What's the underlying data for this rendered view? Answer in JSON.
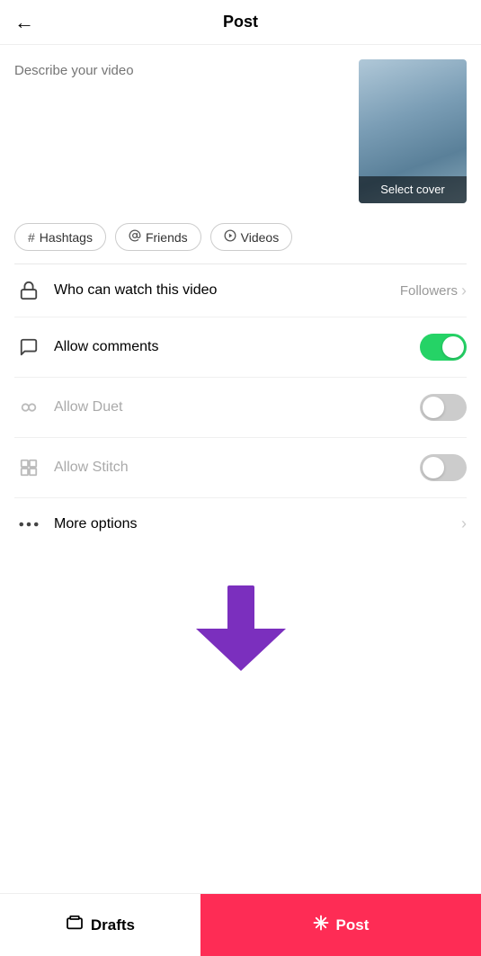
{
  "header": {
    "title": "Post",
    "back_label": "←"
  },
  "description": {
    "placeholder": "Describe your video"
  },
  "cover": {
    "label": "Select cover"
  },
  "tag_buttons": [
    {
      "id": "hashtags",
      "icon": "#",
      "label": "Hashtags"
    },
    {
      "id": "friends",
      "icon": "@",
      "label": "Friends"
    },
    {
      "id": "videos",
      "icon": "▷",
      "label": "Videos"
    }
  ],
  "settings": [
    {
      "id": "who-can-watch",
      "label": "Who can watch this video",
      "value": "Followers",
      "type": "chevron",
      "disabled": false
    },
    {
      "id": "allow-comments",
      "label": "Allow comments",
      "type": "toggle",
      "checked": true,
      "disabled": false
    },
    {
      "id": "allow-duet",
      "label": "Allow Duet",
      "type": "toggle",
      "checked": false,
      "disabled": true
    },
    {
      "id": "allow-stitch",
      "label": "Allow Stitch",
      "type": "toggle",
      "checked": false,
      "disabled": true
    },
    {
      "id": "more-options",
      "label": "More options",
      "type": "chevron",
      "disabled": false
    }
  ],
  "bottom_bar": {
    "drafts_icon": "▭",
    "drafts_label": "Drafts",
    "post_icon": "✳",
    "post_label": "Post"
  }
}
